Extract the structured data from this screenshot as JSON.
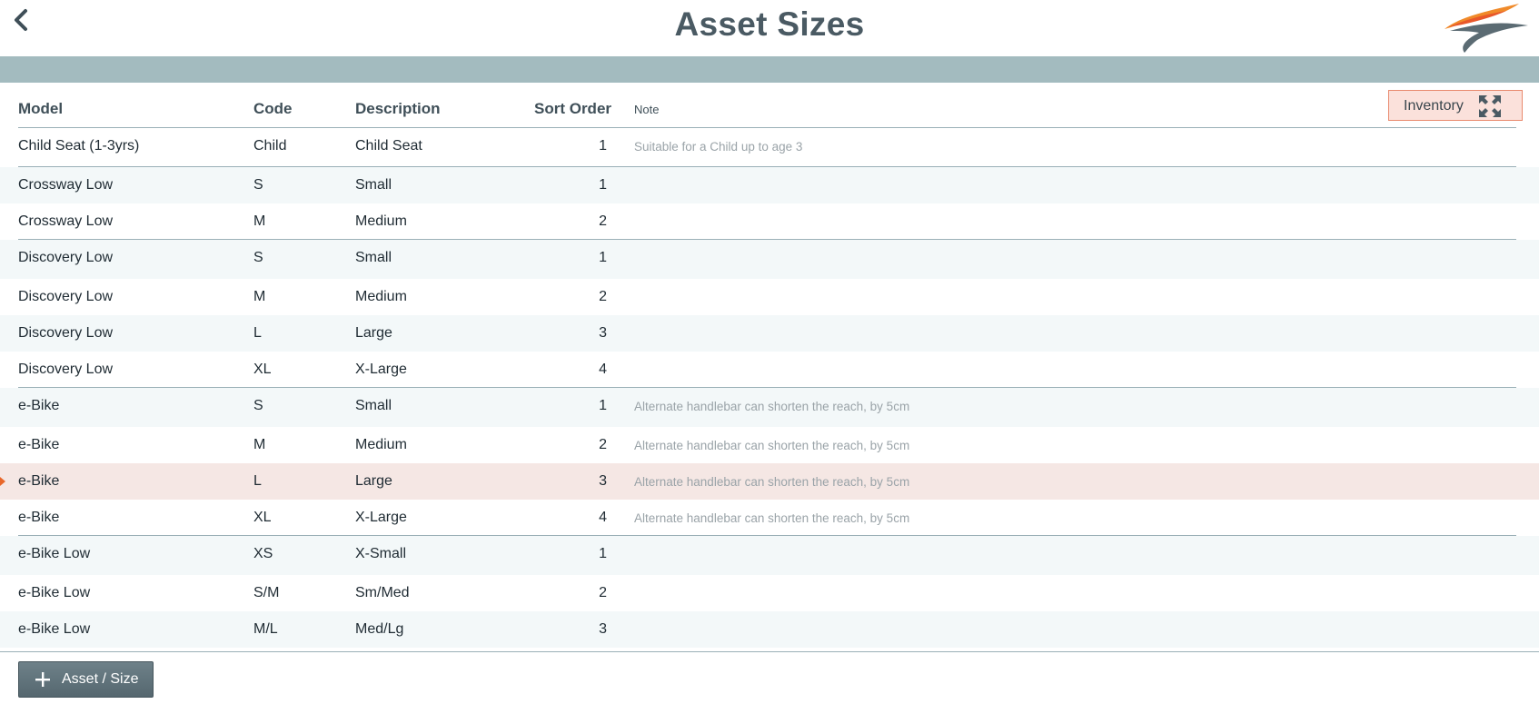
{
  "app": {
    "title": "Asset Sizes"
  },
  "columns": {
    "model": "Model",
    "code": "Code",
    "description": "Description",
    "sort_order": "Sort Order",
    "note": "Note"
  },
  "toolbar": {
    "inventory_label": "Inventory",
    "add_label": "Asset / Size"
  },
  "colors": {
    "band": "#a3bbbf",
    "accent": "#e8672a",
    "selected_row": "#f5e7e4",
    "title": "#4a5a63"
  },
  "icons": {
    "back": "chevron-left-icon",
    "inventory": "expand-icon",
    "add": "plus-icon",
    "logo": "swoosh-logo"
  },
  "rows": [
    {
      "model": "Child Seat (1-3yrs)",
      "code": "Child",
      "description": "Child Seat",
      "sort_order": "1",
      "note": "Suitable for a Child up to age 3"
    },
    {
      "model": "Crossway Low",
      "code": "S",
      "description": "Small",
      "sort_order": "1",
      "note": ""
    },
    {
      "model": "Crossway Low",
      "code": "M",
      "description": "Medium",
      "sort_order": "2",
      "note": ""
    },
    {
      "model": "Discovery Low",
      "code": "S",
      "description": "Small",
      "sort_order": "1",
      "note": ""
    },
    {
      "model": "Discovery Low",
      "code": "M",
      "description": "Medium",
      "sort_order": "2",
      "note": ""
    },
    {
      "model": "Discovery Low",
      "code": "L",
      "description": "Large",
      "sort_order": "3",
      "note": ""
    },
    {
      "model": "Discovery Low",
      "code": "XL",
      "description": "X-Large",
      "sort_order": "4",
      "note": ""
    },
    {
      "model": "e-Bike",
      "code": "S",
      "description": "Small",
      "sort_order": "1",
      "note": "Alternate handlebar can shorten the reach, by 5cm"
    },
    {
      "model": "e-Bike",
      "code": "M",
      "description": "Medium",
      "sort_order": "2",
      "note": "Alternate handlebar can shorten the reach, by 5cm"
    },
    {
      "model": "e-Bike",
      "code": "L",
      "description": "Large",
      "sort_order": "3",
      "note": "Alternate handlebar can shorten the reach, by 5cm",
      "selected": true
    },
    {
      "model": "e-Bike",
      "code": "XL",
      "description": "X-Large",
      "sort_order": "4",
      "note": "Alternate handlebar can shorten the reach, by 5cm"
    },
    {
      "model": "e-Bike Low",
      "code": "XS",
      "description": "X-Small",
      "sort_order": "1",
      "note": ""
    },
    {
      "model": "e-Bike Low",
      "code": "S/M",
      "description": "Sm/Med",
      "sort_order": "2",
      "note": ""
    },
    {
      "model": "e-Bike Low",
      "code": "M/L",
      "description": "Med/Lg",
      "sort_order": "3",
      "note": ""
    }
  ]
}
